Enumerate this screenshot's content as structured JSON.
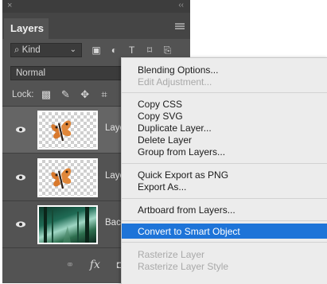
{
  "panel": {
    "close_glyph": "×",
    "collapse_glyph": "‹‹",
    "tab_label": "Layers",
    "filter": {
      "value": "Kind",
      "prefix_icon": "search-icon"
    },
    "blend_mode": "Normal",
    "opacity_label": "O",
    "lock_label": "Lock:",
    "layers": [
      {
        "name": "Laye",
        "thumbnail": "butterfly",
        "selected": true
      },
      {
        "name": "Laye",
        "thumbnail": "butterfly",
        "selected": false
      },
      {
        "name": "Back",
        "thumbnail": "forest",
        "selected": false
      }
    ],
    "bottom_icons": [
      "link-icon",
      "fx-icon",
      "mask-icon",
      "adjustment-icon"
    ]
  },
  "context_menu": {
    "highlight_color": "#1e74d8",
    "groups": [
      [
        {
          "label": "Blending Options...",
          "enabled": true
        },
        {
          "label": "Edit Adjustment...",
          "enabled": false
        }
      ],
      [
        {
          "label": "Copy CSS",
          "enabled": true
        },
        {
          "label": "Copy SVG",
          "enabled": true
        },
        {
          "label": "Duplicate Layer...",
          "enabled": true
        },
        {
          "label": "Delete Layer",
          "enabled": true
        },
        {
          "label": "Group from Layers...",
          "enabled": true
        }
      ],
      [
        {
          "label": "Quick Export as PNG",
          "enabled": true
        },
        {
          "label": "Export As...",
          "enabled": true
        }
      ],
      [
        {
          "label": "Artboard from Layers...",
          "enabled": true
        }
      ],
      [
        {
          "label": "Convert to Smart Object",
          "enabled": true,
          "highlighted": true
        }
      ],
      [
        {
          "label": "Rasterize Layer",
          "enabled": false
        },
        {
          "label": "Rasterize Layer Style",
          "enabled": false
        }
      ]
    ]
  }
}
